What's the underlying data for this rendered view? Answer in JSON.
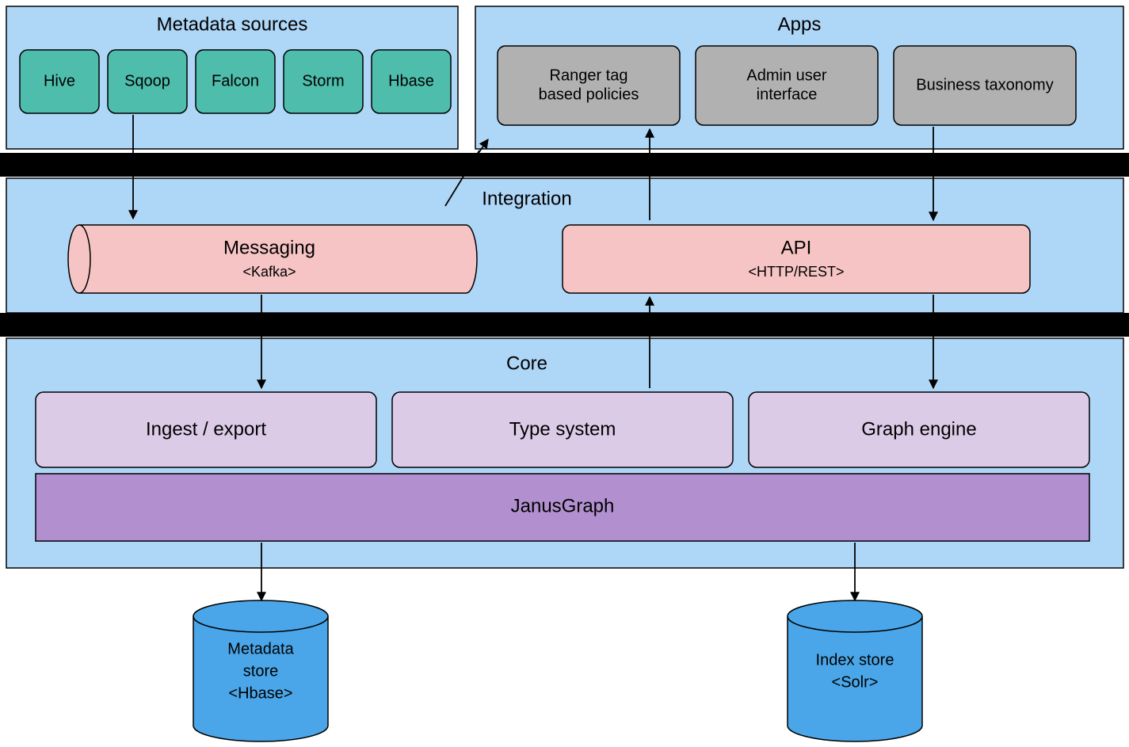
{
  "metadata_sources": {
    "title": "Metadata sources",
    "items": [
      "Hive",
      "Sqoop",
      "Falcon",
      "Storm",
      "Hbase"
    ]
  },
  "apps": {
    "title": "Apps",
    "items": [
      {
        "l1": "Ranger tag",
        "l2": "based policies"
      },
      {
        "l1": "Admin user",
        "l2": "interface"
      },
      {
        "l1": "Business taxonomy",
        "l2": ""
      }
    ]
  },
  "integration": {
    "title": "Integration",
    "messaging": {
      "name": "Messaging",
      "tech": "<Kafka>"
    },
    "api": {
      "name": "API",
      "tech": "<HTTP/REST>"
    }
  },
  "core": {
    "title": "Core",
    "modules": [
      "Ingest / export",
      "Type system",
      "Graph engine"
    ],
    "janus": "JanusGraph"
  },
  "stores": {
    "metadata": {
      "l1": "Metadata",
      "l2": "store",
      "l3": "<Hbase>"
    },
    "index": {
      "l1": "Index store",
      "l2": "<Solr>",
      "l3": ""
    }
  }
}
